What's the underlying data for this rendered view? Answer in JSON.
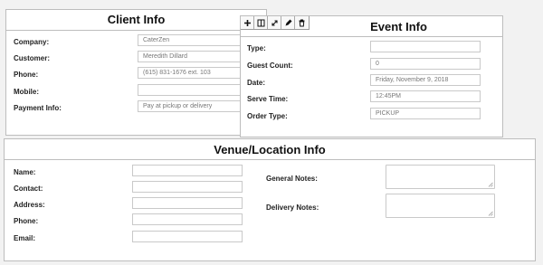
{
  "client": {
    "title": "Client Info",
    "fields": [
      {
        "label": "Company:",
        "value": "CaterZen"
      },
      {
        "label": "Customer:",
        "value": "Meredith Dillard"
      },
      {
        "label": "Phone:",
        "value": "(615) 831-1676 ext. 103"
      },
      {
        "label": "Mobile:",
        "value": ""
      },
      {
        "label": "Payment Info:",
        "value": "Pay at pickup or delivery"
      }
    ]
  },
  "event": {
    "title": "Event Info",
    "toolbar": [
      "plus-icon",
      "columns-icon",
      "resize-icon",
      "pencil-icon",
      "trash-icon"
    ],
    "fields": [
      {
        "label": "Type:",
        "value": ""
      },
      {
        "label": "Guest Count:",
        "value": "0"
      },
      {
        "label": "Date:",
        "value": "Friday, November 9, 2018"
      },
      {
        "label": "Serve Time:",
        "value": "12:45PM"
      },
      {
        "label": "Order Type:",
        "value": "PICKUP"
      }
    ]
  },
  "venue": {
    "title": "Venue/Location Info",
    "fields": [
      {
        "label": "Name:",
        "value": ""
      },
      {
        "label": "Contact:",
        "value": ""
      },
      {
        "label": "Address:",
        "value": ""
      },
      {
        "label": "Phone:",
        "value": ""
      },
      {
        "label": "Email:",
        "value": ""
      }
    ],
    "notes": [
      {
        "label": "General Notes:",
        "value": ""
      },
      {
        "label": "Delivery Notes:",
        "value": ""
      }
    ]
  }
}
